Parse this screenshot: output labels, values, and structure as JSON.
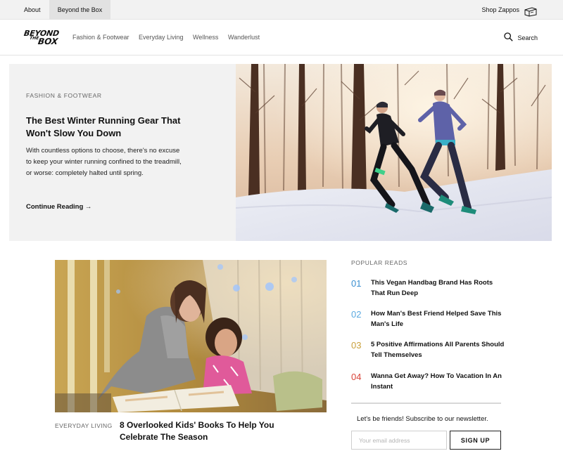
{
  "utility_bar": {
    "about_label": "About",
    "active_label": "Beyond the Box",
    "shop_label": "Shop Zappos",
    "shop_icon": "box-icon"
  },
  "nav": {
    "logo": {
      "line1": "BEYOND",
      "line2": "THE",
      "line3": "BOX"
    },
    "links": [
      "Fashion & Footwear",
      "Everyday Living",
      "Wellness",
      "Wanderlust"
    ],
    "search_label": "Search",
    "search_icon": "search-icon"
  },
  "hero": {
    "category": "FASHION & FOOTWEAR",
    "title": "The Best Winter Running Gear That Won't Slow You Down",
    "description": "With countless options to choose, there's no excuse to keep your winter running confined to the treadmill, or worse: completely halted until spring.",
    "cta": "Continue Reading →"
  },
  "feature": {
    "category": "EVERYDAY LIVING",
    "title": "8 Overlooked Kids' Books To Help You Celebrate The Season"
  },
  "popular": {
    "heading": "POPULAR READS",
    "items": [
      {
        "num": "01",
        "title": "This Vegan Handbag Brand Has Roots That Run Deep",
        "color": "#3a8fd0"
      },
      {
        "num": "02",
        "title": "How Man's Best Friend Helped Save This Man's Life",
        "color": "#5aa9e0"
      },
      {
        "num": "03",
        "title": "5 Positive Affirmations All Parents Should Tell Themselves",
        "color": "#c9a03c"
      },
      {
        "num": "04",
        "title": "Wanna Get Away? How To Vacation In An Instant",
        "color": "#d9453b"
      }
    ]
  },
  "newsletter": {
    "text": "Let's be friends! Subscribe to our newsletter.",
    "placeholder": "Your email address",
    "button": "SIGN UP"
  }
}
